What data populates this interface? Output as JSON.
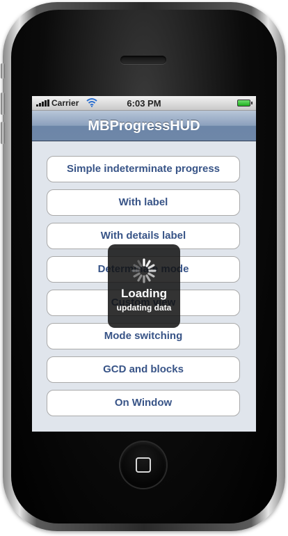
{
  "status_bar": {
    "carrier": "Carrier",
    "time": "6:03 PM"
  },
  "nav": {
    "title": "MBProgressHUD"
  },
  "menu": {
    "items": [
      "Simple indeterminate progress",
      "With label",
      "With details label",
      "Determinate mode",
      "Custom view",
      "Mode switching",
      "GCD and blocks",
      "On Window"
    ]
  },
  "hud": {
    "label": "Loading",
    "details": "updating data"
  },
  "colors": {
    "button_text": "#385487",
    "content_bg": "#e0e5ec",
    "nav_bar": "#7b93b3",
    "hud_bg": "#121212"
  },
  "icons": [
    "signal-bars-icon",
    "wifi-icon",
    "battery-icon",
    "activity-spinner-icon",
    "home-button-icon"
  ]
}
